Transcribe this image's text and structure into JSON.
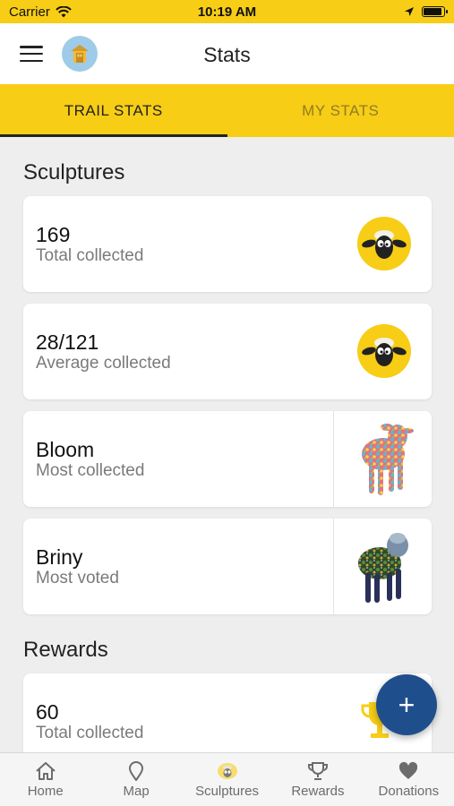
{
  "status_bar": {
    "carrier": "Carrier",
    "time": "10:19 AM"
  },
  "nav": {
    "title": "Stats"
  },
  "tabs": [
    {
      "label": "TRAIL STATS",
      "active": true
    },
    {
      "label": "MY STATS",
      "active": false
    }
  ],
  "sculptures": {
    "title": "Sculptures",
    "cards": [
      {
        "value": "169",
        "label": "Total collected",
        "icon": "sheep-icon"
      },
      {
        "value": "28/121",
        "label": "Average collected",
        "icon": "sheep-icon"
      },
      {
        "value": "Bloom",
        "label": "Most collected",
        "image": "bloom-sculpture"
      },
      {
        "value": "Briny",
        "label": "Most voted",
        "image": "briny-sculpture"
      }
    ]
  },
  "rewards": {
    "title": "Rewards",
    "cards": [
      {
        "value": "60",
        "label": "Total collected",
        "icon": "trophy-icon"
      }
    ]
  },
  "fab": {
    "label": "+"
  },
  "tabbar": [
    {
      "label": "Home",
      "icon": "home-icon"
    },
    {
      "label": "Map",
      "icon": "map-pin-icon"
    },
    {
      "label": "Sculptures",
      "icon": "sheep-icon"
    },
    {
      "label": "Rewards",
      "icon": "trophy-icon"
    },
    {
      "label": "Donations",
      "icon": "heart-icon"
    }
  ],
  "colors": {
    "accent": "#f7cd16",
    "fab": "#1f4e8c",
    "background": "#eeeeef"
  }
}
